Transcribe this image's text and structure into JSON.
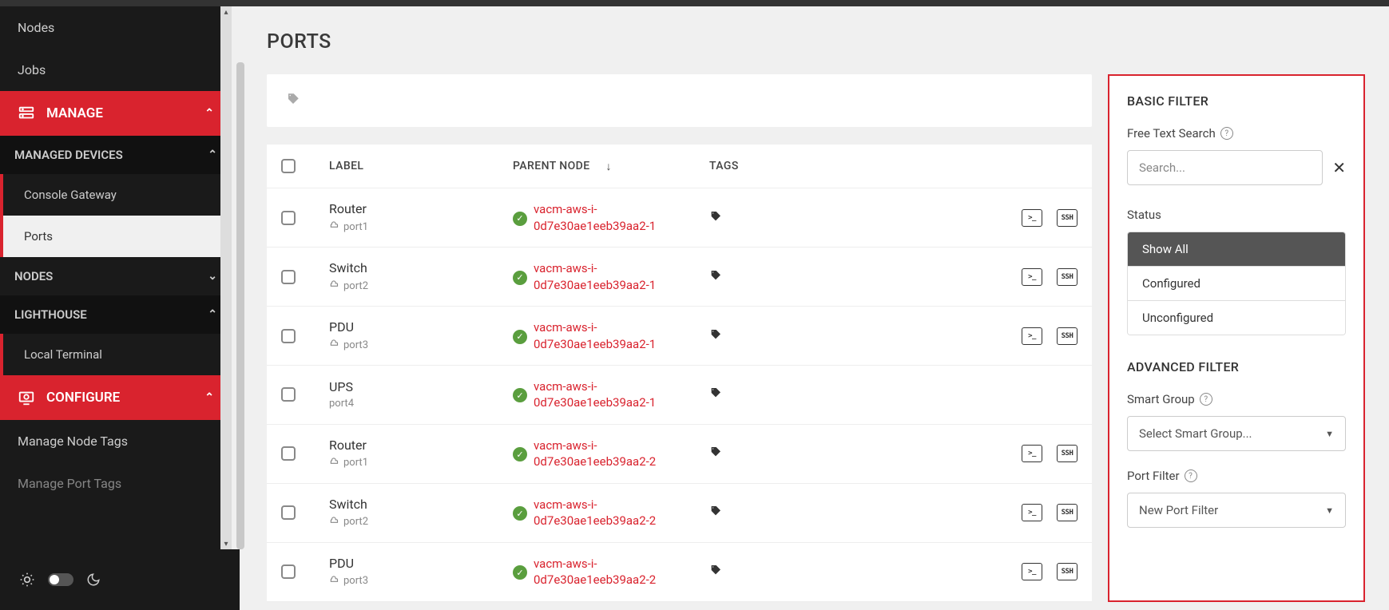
{
  "sidebar": {
    "nodes": "Nodes",
    "jobs": "Jobs",
    "manage": "MANAGE",
    "managed_devices": "MANAGED DEVICES",
    "console_gateway": "Console Gateway",
    "ports": "Ports",
    "nodes_section": "NODES",
    "lighthouse": "LIGHTHOUSE",
    "local_terminal": "Local Terminal",
    "configure": "CONFIGURE",
    "manage_node_tags": "Manage Node Tags",
    "manage_port_tags": "Manage Port Tags"
  },
  "page": {
    "title": "PORTS"
  },
  "table": {
    "headers": {
      "label": "LABEL",
      "parent": "PARENT NODE",
      "tags": "TAGS"
    },
    "rows": [
      {
        "label": "Router",
        "port": "port1",
        "parent": "vacm-aws-i-0d7e30ae1eeb39aa2-1",
        "has_port_icon": true,
        "terminal": true,
        "ssh": true
      },
      {
        "label": "Switch",
        "port": "port2",
        "parent": "vacm-aws-i-0d7e30ae1eeb39aa2-1",
        "has_port_icon": true,
        "terminal": true,
        "ssh": true
      },
      {
        "label": "PDU",
        "port": "port3",
        "parent": "vacm-aws-i-0d7e30ae1eeb39aa2-1",
        "has_port_icon": true,
        "terminal": true,
        "ssh": true
      },
      {
        "label": "UPS",
        "port": "port4",
        "parent": "vacm-aws-i-0d7e30ae1eeb39aa2-1",
        "has_port_icon": false,
        "terminal": false,
        "ssh": false
      },
      {
        "label": "Router",
        "port": "port1",
        "parent": "vacm-aws-i-0d7e30ae1eeb39aa2-2",
        "has_port_icon": true,
        "terminal": true,
        "ssh": true
      },
      {
        "label": "Switch",
        "port": "port2",
        "parent": "vacm-aws-i-0d7e30ae1eeb39aa2-2",
        "has_port_icon": true,
        "terminal": true,
        "ssh": true
      },
      {
        "label": "PDU",
        "port": "port3",
        "parent": "vacm-aws-i-0d7e30ae1eeb39aa2-2",
        "has_port_icon": true,
        "terminal": true,
        "ssh": true
      }
    ]
  },
  "filter": {
    "basic_title": "BASIC FILTER",
    "free_text_label": "Free Text Search",
    "search_placeholder": "Search...",
    "status_label": "Status",
    "status_options": [
      "Show All",
      "Configured",
      "Unconfigured"
    ],
    "status_selected": 0,
    "advanced_title": "ADVANCED FILTER",
    "smart_group_label": "Smart Group",
    "smart_group_value": "Select Smart Group...",
    "port_filter_label": "Port Filter",
    "port_filter_value": "New Port Filter"
  },
  "actions": {
    "terminal": ">_",
    "ssh": "SSH"
  }
}
